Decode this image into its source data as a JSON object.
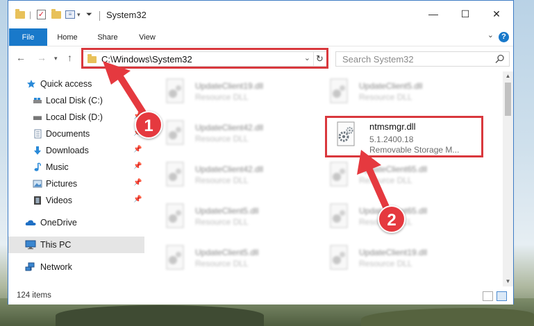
{
  "window": {
    "title": "System32",
    "controls": {
      "minimize": "—",
      "maximize": "☐",
      "close": "✕"
    }
  },
  "ribbon": {
    "tabs": [
      "File",
      "Home",
      "Share",
      "View"
    ],
    "help": "?",
    "expand": "⌄"
  },
  "address": {
    "path": "C:\\Windows\\System32",
    "search_placeholder": "Search System32"
  },
  "navpane": {
    "items": [
      {
        "label": "Quick access",
        "icon": "star-icon",
        "pinned": false
      },
      {
        "label": "Local Disk (C:)",
        "icon": "drive-icon",
        "pinned": false
      },
      {
        "label": "Local Disk (D:)",
        "icon": "drive-icon",
        "pinned": true
      },
      {
        "label": "Documents",
        "icon": "documents-icon",
        "pinned": true
      },
      {
        "label": "Downloads",
        "icon": "download-arrow-icon",
        "pinned": true
      },
      {
        "label": "Music",
        "icon": "music-note-icon",
        "pinned": true
      },
      {
        "label": "Pictures",
        "icon": "pictures-icon",
        "pinned": true
      },
      {
        "label": "Videos",
        "icon": "film-icon",
        "pinned": true
      },
      {
        "label": "OneDrive",
        "icon": "cloud-icon",
        "pinned": false
      },
      {
        "label": "This PC",
        "icon": "monitor-icon",
        "pinned": false
      },
      {
        "label": "Network",
        "icon": "network-icon",
        "pinned": false
      }
    ],
    "selected": "This PC"
  },
  "files": {
    "left_column": [
      {
        "name": "UpdateClient19.dll",
        "desc": "Resource DLL"
      },
      {
        "name": "UpdateClient42.dll",
        "desc": "Resource DLL"
      },
      {
        "name": "UpdateClient42.dll",
        "desc": "Resource DLL"
      },
      {
        "name": "UpdateClient5.dll",
        "desc": "Resource DLL"
      },
      {
        "name": "UpdateClient5.dll",
        "desc": "Resource DLL"
      }
    ],
    "right_column": [
      {
        "name": "UpdateClient5.dll",
        "desc": "Resource DLL"
      },
      {
        "name": "UpdateClient65.dll",
        "desc": "Resource DLL"
      },
      {
        "name": "UpdateClient65.dll",
        "desc": "Resource DLL"
      },
      {
        "name": "UpdateClient19.dll",
        "desc": "Resource DLL"
      }
    ],
    "highlighted": {
      "name": "ntmsmgr.dll",
      "version": "5.1.2400.18",
      "desc": "Removable Storage M..."
    }
  },
  "status": {
    "item_count": "124 items"
  },
  "annotations": {
    "step1": "1",
    "step2": "2"
  },
  "colors": {
    "accent": "#1979ca",
    "annotation": "#d9383d"
  }
}
